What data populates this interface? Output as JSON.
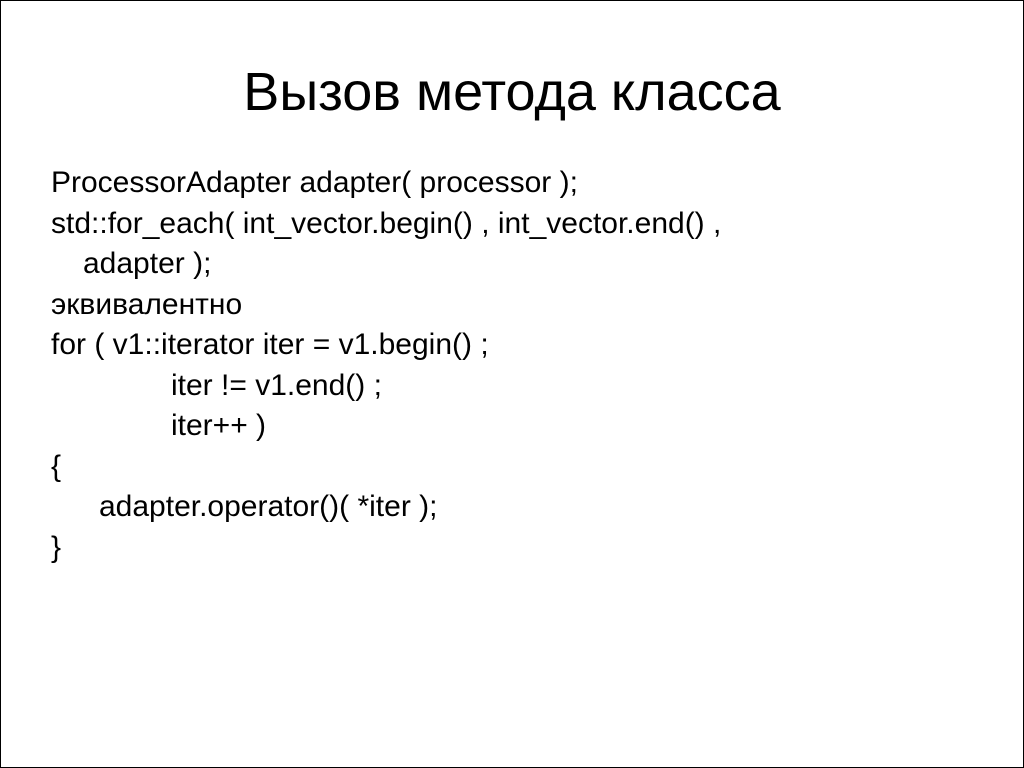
{
  "title": "Вызов метода класса",
  "lines": {
    "l1": "ProcessorAdapter adapter( processor );",
    "l2a": "std::for_each( int_vector.begin() , int_vector.end() ,",
    "l2b": "adapter );",
    "l3": "эквивалентно",
    "l4": "for ( v1::iterator iter = v1.begin() ;",
    "l5": "iter != v1.end() ;",
    "l6": "iter++ )",
    "l7": "{",
    "l8": "adapter.operator()( *iter );",
    "l9": "}"
  }
}
